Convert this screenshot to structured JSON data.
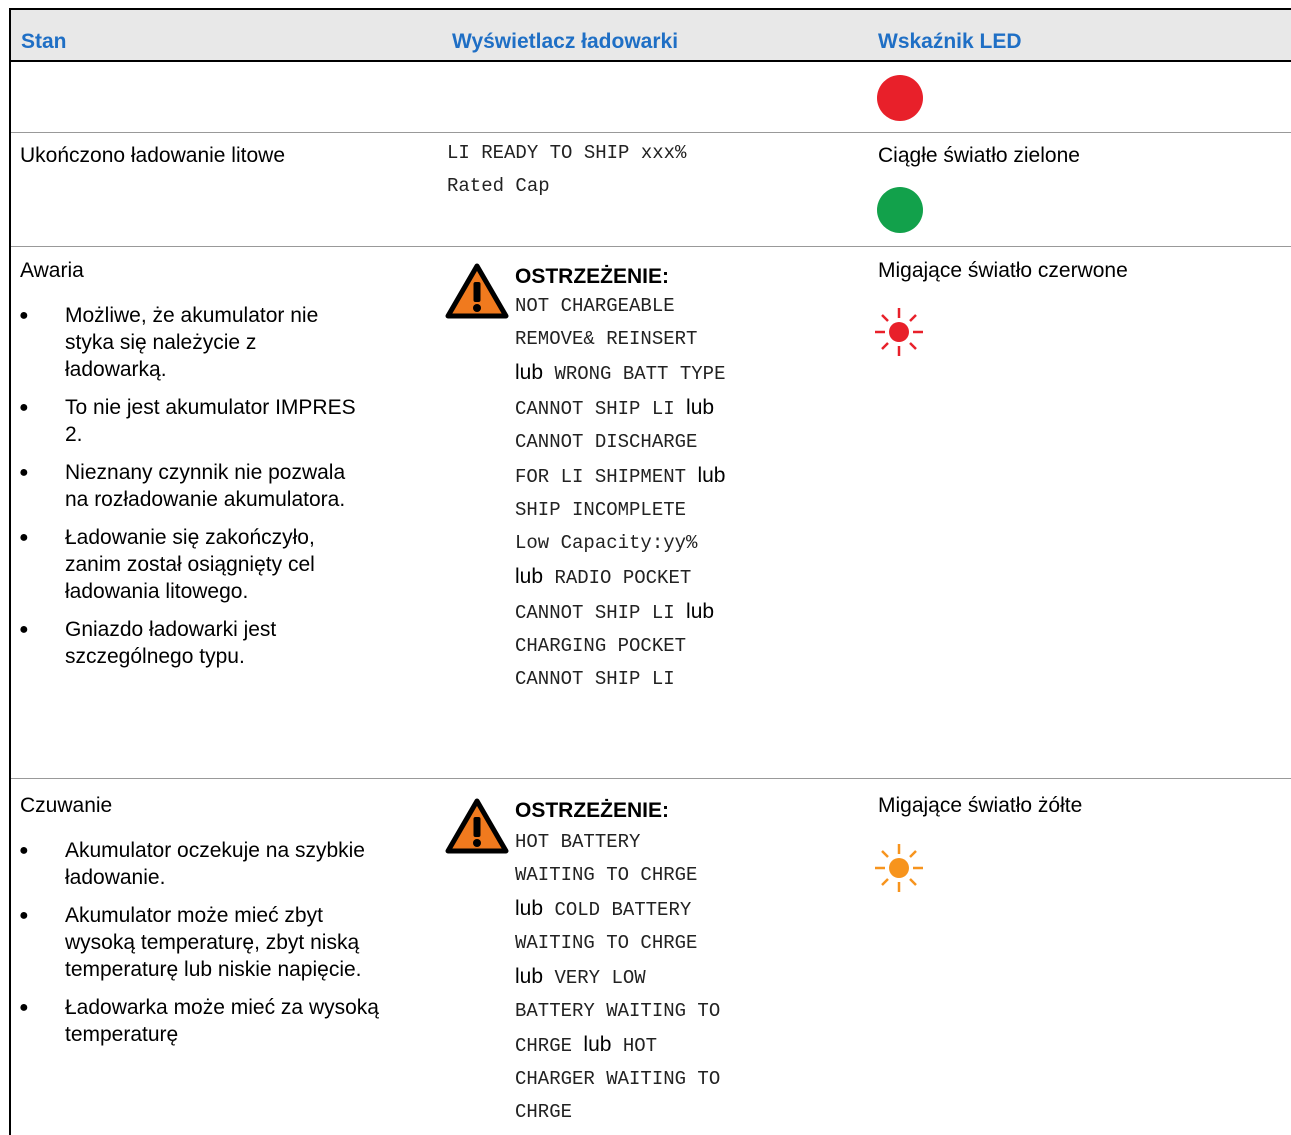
{
  "header": {
    "col1": "Stan",
    "col2": "Wyświetlacz ładowarki",
    "col3": "Wskaźnik LED"
  },
  "colors": {
    "header_text": "#1f6fc5",
    "led_red": "#e8202a",
    "led_green": "#12a14b",
    "led_amber": "#f7941d",
    "warning": "#f07a1e"
  },
  "rows": [
    {
      "led_icon": "red-led-icon"
    },
    {
      "state": "Ukończono ładowanie litowe",
      "display_lines": [
        "LI READY TO SHIP xxx%",
        "Rated Cap"
      ],
      "led_label": "Ciągłe światło zielone",
      "led_icon": "green-led-icon"
    },
    {
      "state": "Awaria",
      "bullets": [
        "Możliwe, że akumulator nie styka się należycie z ładowarką.",
        "To nie jest akumulator IMPRES 2.",
        "Nieznany czynnik nie pozwala na rozładowanie akumulatora.",
        "Ładowanie się zakończyło, zanim został osiągnięty cel ładowania litowego.",
        "Gniazdo ładowarki jest szczególnego typu."
      ],
      "warning_title": "OSTRZEŻENIE:",
      "display": {
        "l1": "NOT CHARGEABLE",
        "l2": "REMOVE& REINSERT",
        "l3": "WRONG BATT TYPE",
        "l4": "CANNOT SHIP LI",
        "l5": "CANNOT DISCHARGE",
        "l6": "FOR LI SHIPMENT",
        "l7": "SHIP INCOMPLETE",
        "l8": "Low Capacity:yy%",
        "l9": "RADIO POCKET",
        "l10": "CANNOT SHIP LI",
        "l11": "CHARGING POCKET",
        "l12": "CANNOT SHIP LI",
        "or": "lub"
      },
      "led_label": "Migające światło czerwone",
      "led_icon": "red-blinking-led-icon"
    },
    {
      "state": "Czuwanie",
      "bullets": [
        "Akumulator oczekuje na szybkie ładowanie.",
        "Akumulator może mieć zbyt wysoką temperaturę, zbyt niską temperaturę lub niskie napięcie.",
        "Ładowarka może mieć za wysoką temperaturę"
      ],
      "warning_title": "OSTRZEŻENIE:",
      "display": {
        "l1": "HOT BATTERY",
        "l2": "WAITING TO CHRGE",
        "l3": "COLD BATTERY",
        "l4": "WAITING TO CHRGE",
        "l5": "VERY LOW",
        "l6": "BATTERY WAITING TO",
        "l7": "CHRGE",
        "l8": "HOT",
        "l9": "CHARGER WAITING TO",
        "l10": "CHRGE",
        "or": "lub"
      },
      "led_label": "Migające światło żółte",
      "led_icon": "amber-blinking-led-icon"
    }
  ]
}
